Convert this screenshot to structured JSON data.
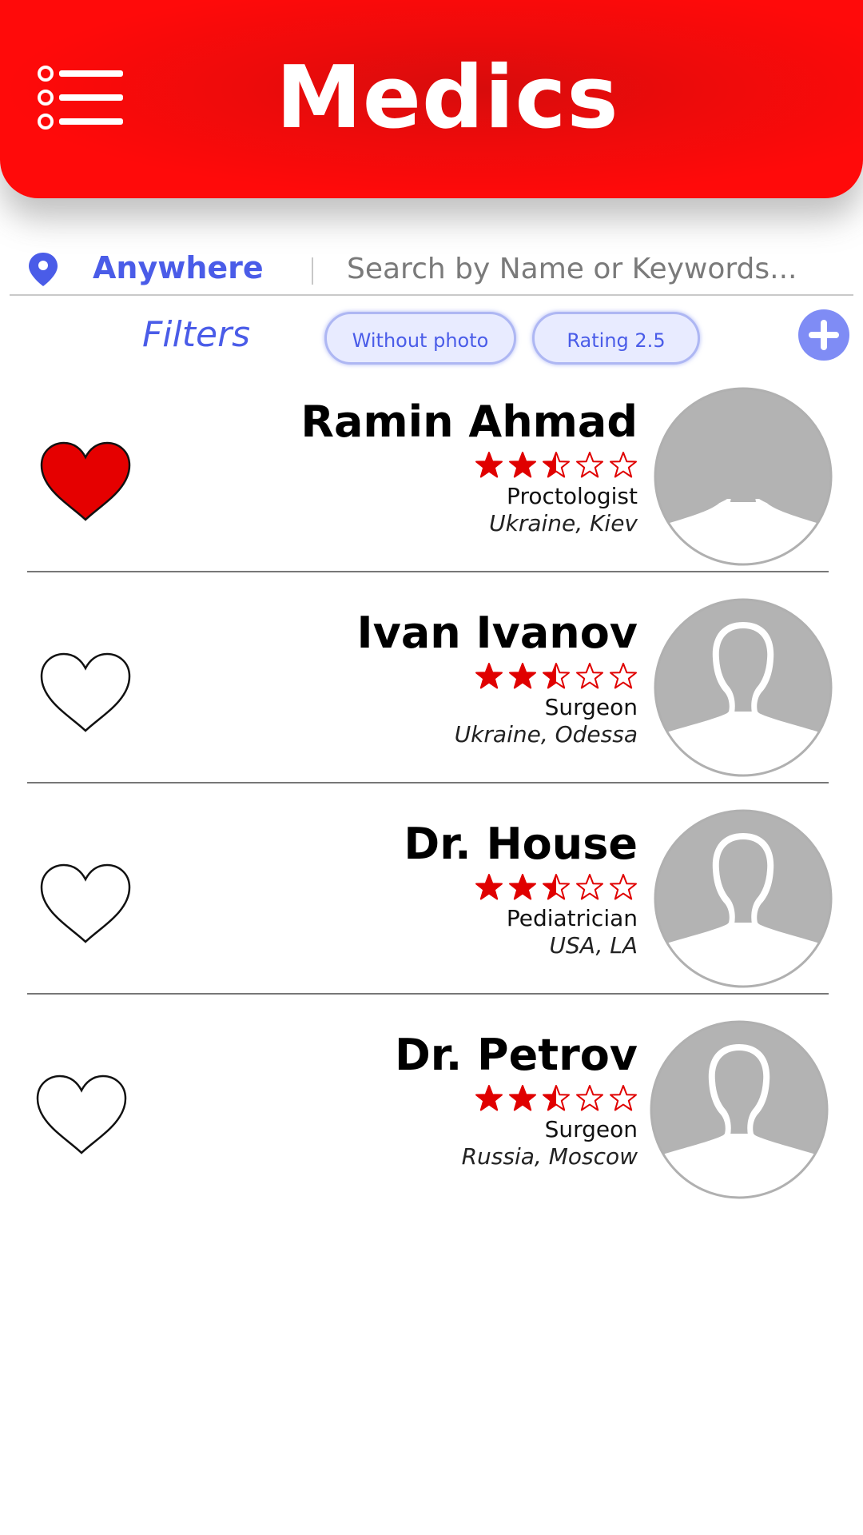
{
  "app": {
    "title": "Medics",
    "accent_color": "#ff0a0a",
    "link_color": "#4a5ce8"
  },
  "header": {
    "menu_icon": "menu-list-icon"
  },
  "search": {
    "location_icon": "location-pin-icon",
    "location": "Anywhere",
    "placeholder": "Search by Name or Keywords...",
    "value": ""
  },
  "filters": {
    "label": "Filters",
    "chips": [
      {
        "label": "Without photo"
      },
      {
        "label": "Rating 2.5"
      }
    ],
    "add_icon": "plus-circle-icon"
  },
  "doctors": [
    {
      "name": "Ramin Ahmad",
      "rating": 2.5,
      "max_rating": 5,
      "specialty": "Proctologist",
      "location": "Ukraine, Kiev",
      "favorite": true
    },
    {
      "name": "Ivan Ivanov",
      "rating": 2.5,
      "max_rating": 5,
      "specialty": "Surgeon",
      "location": "Ukraine, Odessa",
      "favorite": false
    },
    {
      "name": "Dr. House",
      "rating": 2.5,
      "max_rating": 5,
      "specialty": "Pediatrician",
      "location": "USA, LA",
      "favorite": false
    },
    {
      "name": "Dr. Petrov",
      "rating": 2.5,
      "max_rating": 5,
      "specialty": "Surgeon",
      "location": "Russia, Moscow",
      "favorite": false
    }
  ]
}
